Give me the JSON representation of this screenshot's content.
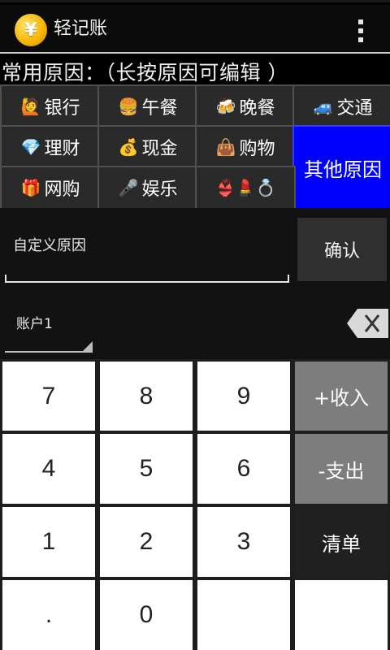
{
  "app": {
    "title": "轻记账",
    "logo_symbol": "¥",
    "overflow_icon": "overflow-menu-icon"
  },
  "reasons": {
    "header": "常用原因：（长按原因可编辑 ）",
    "items": [
      {
        "emoji": "🙋",
        "label": "银行"
      },
      {
        "emoji": "🍔",
        "label": "午餐"
      },
      {
        "emoji": "🍻",
        "label": "晚餐"
      },
      {
        "emoji": "🚙",
        "label": "交通"
      },
      {
        "emoji": "💎",
        "label": "理财"
      },
      {
        "emoji": "💰",
        "label": "现金"
      },
      {
        "emoji": "👜",
        "label": "购物"
      },
      {
        "emoji": "🎁",
        "label": "网购"
      },
      {
        "emoji": "🎤",
        "label": "娱乐"
      },
      {
        "emoji": "👙💄💍",
        "label": ""
      }
    ],
    "other_label": "其他原因",
    "other_color": "#0000ff"
  },
  "custom": {
    "placeholder": "自定义原因",
    "confirm_label": "确认"
  },
  "account": {
    "selected": "账户1"
  },
  "keypad": {
    "keys": [
      "7",
      "8",
      "9",
      "4",
      "5",
      "6",
      "1",
      "2",
      "3",
      ".",
      "0",
      ""
    ],
    "income_label": "+收入",
    "expense_label": "-支出",
    "list_label": "清单",
    "blank_label": ""
  }
}
